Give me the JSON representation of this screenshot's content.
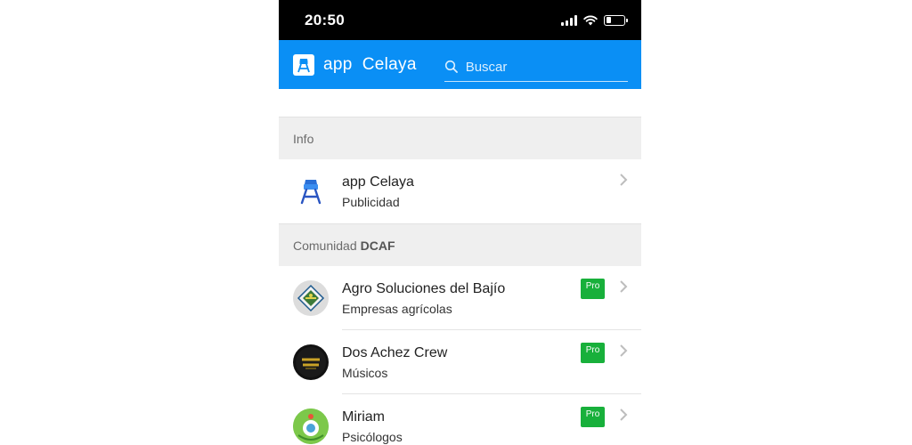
{
  "status": {
    "time": "20:50"
  },
  "header": {
    "app_name": "app  Celaya",
    "search_placeholder": "Buscar"
  },
  "sections": [
    {
      "label": "Info",
      "label_bold": "",
      "items": [
        {
          "title": "app Celaya",
          "subtitle": "Publicidad",
          "pro": false,
          "avatar_icon": "water-tower-icon"
        }
      ]
    },
    {
      "label": "Comunidad",
      "label_bold": "DCAF",
      "items": [
        {
          "title": "Agro Soluciones del Bajío",
          "subtitle": "Empresas agrícolas",
          "pro": true,
          "pro_label": "Pro",
          "avatar_icon": "agro-logo-avatar"
        },
        {
          "title": "Dos Achez Crew",
          "subtitle": "Músicos",
          "pro": true,
          "pro_label": "Pro",
          "avatar_icon": "dos-achez-logo-avatar"
        },
        {
          "title": "Miriam",
          "subtitle": "Psicólogos",
          "pro": true,
          "pro_label": "Pro",
          "avatar_icon": "miriam-logo-avatar"
        }
      ]
    }
  ],
  "colors": {
    "header_bg": "#0a8ff5",
    "pro_badge": "#18b03b",
    "section_bg": "#efefef"
  }
}
